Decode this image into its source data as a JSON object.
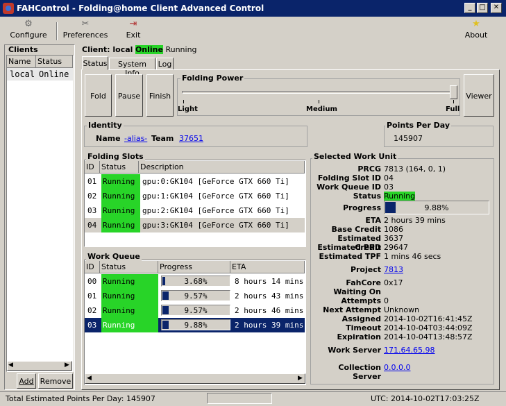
{
  "window": {
    "title": "FAHControl - Folding@home Client Advanced Control"
  },
  "toolbar": {
    "configure": "Configure",
    "preferences": "Preferences",
    "exit": "Exit",
    "about": "About"
  },
  "clients": {
    "title": "Clients",
    "col_name": "Name",
    "col_status": "Status",
    "row_name": "local",
    "row_status": "Online",
    "add": "Add",
    "remove": "Remove"
  },
  "client_header": {
    "prefix": "Client: local",
    "online": "Online",
    "state": "Running"
  },
  "tabs": {
    "status": "Status",
    "system_info": "System Info",
    "log": "Log"
  },
  "buttons": {
    "fold": "Fold",
    "pause": "Pause",
    "finish": "Finish",
    "viewer": "Viewer"
  },
  "folding_power": {
    "title": "Folding Power",
    "light": "Light",
    "medium": "Medium",
    "full": "Full",
    "level": 1.0
  },
  "identity": {
    "title": "Identity",
    "name_label": "Name",
    "name": "-alias-",
    "team_label": "Team",
    "team": "37651"
  },
  "ppd": {
    "title": "Points Per Day",
    "value": "145907"
  },
  "folding_slots": {
    "title": "Folding Slots",
    "headers": [
      "ID",
      "Status",
      "Description"
    ],
    "rows": [
      {
        "id": "01",
        "status": "Running",
        "desc": "gpu:0:GK104 [GeForce GTX 660 Ti]"
      },
      {
        "id": "02",
        "status": "Running",
        "desc": "gpu:1:GK104 [GeForce GTX 660 Ti]"
      },
      {
        "id": "03",
        "status": "Running",
        "desc": "gpu:2:GK104 [GeForce GTX 660 Ti]"
      },
      {
        "id": "04",
        "status": "Running",
        "desc": "gpu:3:GK104 [GeForce GTX 660 Ti]"
      }
    ]
  },
  "work_queue": {
    "title": "Work Queue",
    "headers": [
      "ID",
      "Status",
      "Progress",
      "ETA"
    ],
    "rows": [
      {
        "id": "00",
        "status": "Running",
        "progress": "3.68%",
        "pct": 3.68,
        "eta": "8 hours 14 mins"
      },
      {
        "id": "01",
        "status": "Running",
        "progress": "9.57%",
        "pct": 9.57,
        "eta": "2 hours 43 mins"
      },
      {
        "id": "02",
        "status": "Running",
        "progress": "9.57%",
        "pct": 9.57,
        "eta": "2 hours 46 mins"
      },
      {
        "id": "03",
        "status": "Running",
        "progress": "9.88%",
        "pct": 9.88,
        "eta": "2 hours 39 mins"
      }
    ]
  },
  "selected_wu": {
    "title": "Selected Work Unit",
    "prcg_label": "PRCG",
    "prcg": "7813 (164, 0, 1)",
    "slot_label": "Folding Slot ID",
    "slot": "04",
    "queue_label": "Work Queue ID",
    "queue": "03",
    "status_label": "Status",
    "status": "Running",
    "progress_label": "Progress",
    "progress": "9.88%",
    "progress_pct": 9.88,
    "eta_label": "ETA",
    "eta": "2 hours 39 mins",
    "base_label": "Base Credit",
    "base": "1086",
    "est_label": "Estimated Credit",
    "est": "3637",
    "ppd_label": "Estimated PPD",
    "ppd": "29647",
    "tpf_label": "Estimated TPF",
    "tpf": "1 mins 46 secs",
    "project_label": "Project",
    "project": "7813",
    "core_label": "FahCore",
    "core": "0x17",
    "waiting_label": "Waiting On",
    "waiting": "",
    "attempts_label": "Attempts",
    "attempts": "0",
    "next_label": "Next Attempt",
    "next": "Unknown",
    "assigned_label": "Assigned",
    "assigned": "2014-10-02T16:41:45Z",
    "timeout_label": "Timeout",
    "timeout": "2014-10-04T03:44:09Z",
    "expiration_label": "Expiration",
    "expiration": "2014-10-04T13:48:57Z",
    "ws_label": "Work Server",
    "ws": "171.64.65.98",
    "cs_label": "Collection Server",
    "cs": "0.0.0.0"
  },
  "statusbar": {
    "total": "Total Estimated Points Per Day: 145907",
    "utc": "UTC: 2014-10-02T17:03:25Z"
  }
}
